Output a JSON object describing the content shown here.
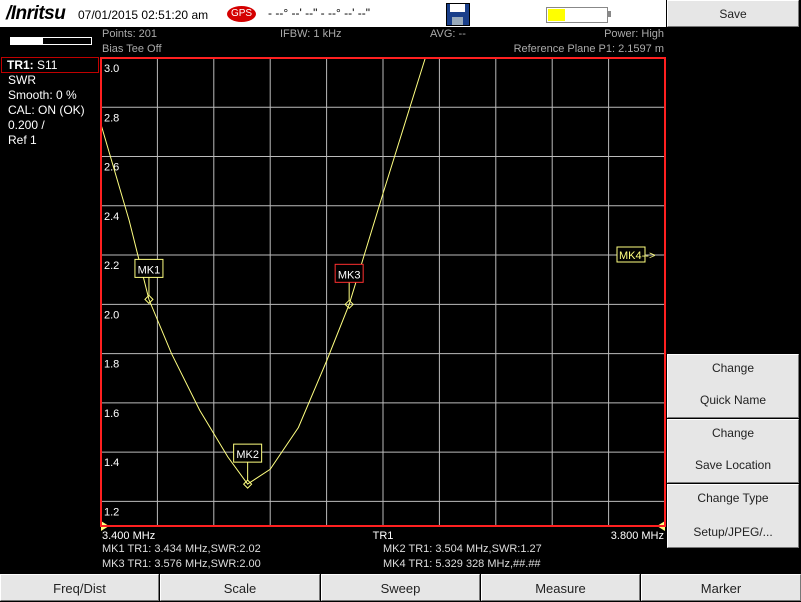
{
  "header": {
    "brand": "/Inritsu",
    "datetime": "07/01/2015 02:51:20 am",
    "gps_badge": "GPS",
    "gps_coords": "- --° --' --\" - --° --' --\"",
    "battery_level": 0.3
  },
  "trace_info": {
    "points": "Points: 201",
    "bias_tee": "Bias Tee Off",
    "ifbw": "IFBW: 1 kHz",
    "avg": "AVG: --",
    "power": "Power: High",
    "reference_plane": "Reference Plane P1: 2.1597 m"
  },
  "left_panel": {
    "trace_name": "TR1:",
    "trace_param": "S11",
    "format": "SWR",
    "smooth": "Smooth: 0 %",
    "cal": "CAL: ON (OK)",
    "scale": "0.200 /",
    "ref": "Ref 1"
  },
  "chart_data": {
    "type": "line",
    "xlim_mhz": [
      3.4,
      3.8
    ],
    "ylim": [
      1.1,
      3.0
    ],
    "y_ticks": [
      "3.0",
      "2.8",
      "2.6",
      "2.4",
      "2.2",
      "2.0",
      "1.8",
      "1.6",
      "1.4",
      "1.2"
    ],
    "x_start_label": "3.400 MHz",
    "x_stop_label": "3.800 MHz",
    "trace_label": "TR1",
    "series": [
      {
        "x": [
          3.4,
          3.42,
          3.434,
          3.45,
          3.47,
          3.49,
          3.504,
          3.52,
          3.54,
          3.56,
          3.576,
          3.6,
          3.63
        ],
        "y": [
          2.73,
          2.34,
          2.02,
          1.8,
          1.57,
          1.38,
          1.27,
          1.33,
          1.5,
          1.77,
          2.0,
          2.45,
          3.0
        ]
      }
    ],
    "markers": [
      {
        "label": "MK1",
        "x": 3.434,
        "y": 2.02
      },
      {
        "label": "MK2",
        "x": 3.504,
        "y": 1.27
      },
      {
        "label": "MK3",
        "x": 3.576,
        "y": 2.0
      },
      {
        "label": "MK4-->",
        "offscreen": true
      }
    ]
  },
  "marker_readouts": {
    "mk1": "MK1 TR1: 3.434 MHz,SWR:2.02",
    "mk2": "MK2 TR1: 3.504 MHz,SWR:1.27",
    "mk3": "MK3 TR1: 3.576 MHz,SWR:2.00",
    "mk4": "MK4 TR1: 5.329 328 MHz,##.##"
  },
  "softkeys": {
    "save": "Save",
    "change_quick_name_1": "Change",
    "change_quick_name_2": "Quick Name",
    "change_save_location_1": "Change",
    "change_save_location_2": "Save Location",
    "change_type_1": "Change Type",
    "change_type_2": "Setup/JPEG/..."
  },
  "menu": {
    "freq_dist": "Freq/Dist",
    "scale": "Scale",
    "sweep": "Sweep",
    "measure": "Measure",
    "marker": "Marker"
  },
  "colors": {
    "trace": "#ffff80",
    "grid": "#bbbbbb",
    "frame": "#ff2020",
    "marker_active": "#ff3030"
  }
}
